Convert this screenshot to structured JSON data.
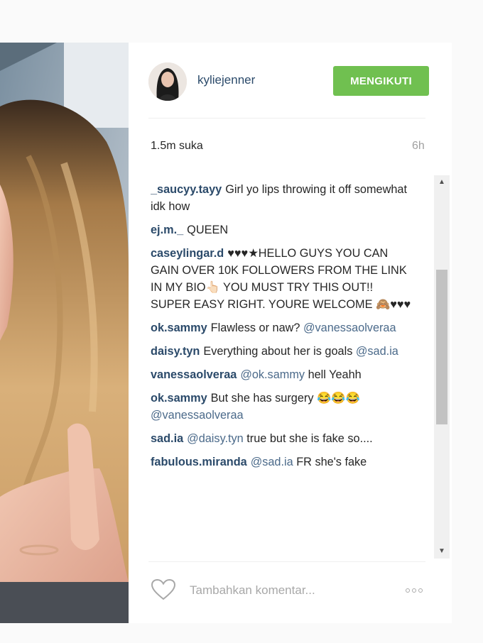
{
  "post": {
    "username": "kyliejenner",
    "follow_label": "MENGIKUTI",
    "likes": "1.5m suka",
    "time": "6h"
  },
  "comments": [
    {
      "user": "_saucyy.tayy",
      "text": "Girl yo lips throwing it off somewhat idk how",
      "mention": ""
    },
    {
      "user": "ej.m._",
      "text": "QUEEN",
      "mention": ""
    },
    {
      "user": "caseylingar.d",
      "text": "♥♥♥★HELLO GUYS YOU CAN GAIN OVER 10K FOLLOWERS FROM THE LINK IN MY BIO👆🏻 YOU MUST TRY THIS OUT!! SUPER EASY RIGHT. YOURE WELCOME 🙈♥♥♥",
      "mention": ""
    },
    {
      "user": "ok.sammy",
      "text": "Flawless or naw?",
      "mention": "@vanessaolveraa"
    },
    {
      "user": "daisy.tyn",
      "text": "Everything about her is goals",
      "mention": "@sad.ia"
    },
    {
      "user": "vanessaolveraa",
      "mention_pre": "@ok.sammy",
      "text": "hell Yeahh"
    },
    {
      "user": "ok.sammy",
      "text": "But she has surgery 😂😂😂",
      "mention": "@vanessaolveraa"
    },
    {
      "user": "sad.ia",
      "mention_pre": "@daisy.tyn",
      "text": "true but she is fake so...."
    },
    {
      "user": "fabulous.miranda",
      "mention_pre": "@sad.ia",
      "text": "FR she's fake"
    }
  ],
  "footer": {
    "comment_placeholder": "Tambahkan komentar..."
  },
  "icons": {
    "like": "heart-icon",
    "more": "more-options-icon",
    "scroll_up": "scroll-up-arrow-icon",
    "scroll_down": "scroll-down-arrow-icon"
  },
  "colors": {
    "follow_button": "#70c050",
    "username": "#2b4a6a"
  }
}
